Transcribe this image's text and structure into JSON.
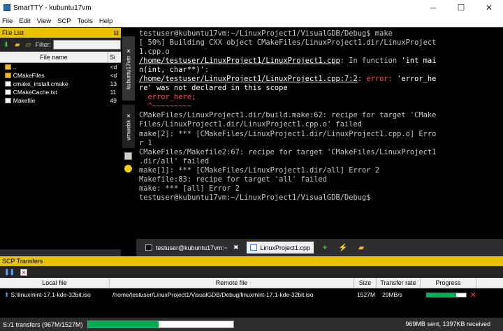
{
  "window": {
    "title": "SmarTTY - kubuntu17vm",
    "minimize": "─",
    "maximize": "☐",
    "close": "✕"
  },
  "menu": [
    "File",
    "Edit",
    "View",
    "SCP",
    "Tools",
    "Help"
  ],
  "file_list": {
    "title": "File List",
    "pin": "⊟",
    "filter_label": "Filter:",
    "filter_value": "",
    "columns": {
      "name": "File name",
      "size": "Si"
    },
    "rows": [
      {
        "name": "..",
        "size": "<d",
        "type": "folder"
      },
      {
        "name": "CMakeFiles",
        "size": "<d",
        "type": "folder"
      },
      {
        "name": "cmake_install.cmake",
        "size": "13",
        "type": "file"
      },
      {
        "name": "CMakeCache.txt",
        "size": "11",
        "type": "file"
      },
      {
        "name": "Makefile",
        "size": "49",
        "type": "file"
      }
    ]
  },
  "vertical_tabs": [
    {
      "label": "kubuntu17vm",
      "close": "✕"
    },
    {
      "label": "vmwebk",
      "close": "✕"
    }
  ],
  "terminal": {
    "lines": [
      [
        {
          "t": "testuser@kubuntu17vm:~/LinuxProject1/VisualGDB/Debug$ make",
          "c": ""
        }
      ],
      [
        {
          "t": "[ 50%] Building CXX object CMakeFiles/LinuxProject1.dir/LinuxProject",
          "c": ""
        }
      ],
      [
        {
          "t": "1.cpp.o",
          "c": ""
        }
      ],
      [
        {
          "t": "/home/testuser/LinuxProject1/LinuxProject1.cpp",
          "c": "u b"
        },
        {
          "t": ": In function ",
          "c": ""
        },
        {
          "t": "'int mai",
          "c": "b"
        }
      ],
      [
        {
          "t": "n(int, char**)'",
          "c": "b"
        },
        {
          "t": ":",
          "c": ""
        }
      ],
      [
        {
          "t": "/home/testuser/LinuxProject1/LinuxProject1.cpp:7:2",
          "c": "u b"
        },
        {
          "t": ": ",
          "c": ""
        },
        {
          "t": "error:",
          "c": "red"
        },
        {
          "t": " 'error_he",
          "c": "b"
        }
      ],
      [
        {
          "t": "re' was not declared in this scope",
          "c": "b"
        }
      ],
      [
        {
          "t": "  error_here;",
          "c": "red"
        }
      ],
      [
        {
          "t": "  ^~~~~~~~~~",
          "c": "red"
        }
      ],
      [
        {
          "t": "CMakeFiles/LinuxProject1.dir/build.make:62: recipe for target 'CMake",
          "c": ""
        }
      ],
      [
        {
          "t": "Files/LinuxProject1.dir/LinuxProject1.cpp.o' failed",
          "c": ""
        }
      ],
      [
        {
          "t": "make[2]: *** [CMakeFiles/LinuxProject1.dir/LinuxProject1.cpp.o] Erro",
          "c": ""
        }
      ],
      [
        {
          "t": "r 1",
          "c": ""
        }
      ],
      [
        {
          "t": "CMakeFiles/Makefile2:67: recipe for target 'CMakeFiles/LinuxProject1",
          "c": ""
        }
      ],
      [
        {
          "t": ".dir/all' failed",
          "c": ""
        }
      ],
      [
        {
          "t": "make[1]: *** [CMakeFiles/LinuxProject1.dir/all] Error 2",
          "c": ""
        }
      ],
      [
        {
          "t": "Makefile:83: recipe for target 'all' failed",
          "c": ""
        }
      ],
      [
        {
          "t": "make: *** [all] Error 2",
          "c": ""
        }
      ],
      [
        {
          "t": "testuser@kubuntu17vm:~/LinuxProject1/VisualGDB/Debug$",
          "c": ""
        }
      ]
    ]
  },
  "bottom_tabs": {
    "terminal_tab": "testuser@kubuntu17vm:~",
    "terminal_close": "✖",
    "file_tab": "LinuxProject1.cpp"
  },
  "scp": {
    "title": "SCP Transfers",
    "columns": [
      "Local file",
      "Remote file",
      "Size",
      "Transfer rate",
      "Progress"
    ],
    "rows": [
      {
        "local": "S:\\linuxmint-17.1-kde-32bit.iso",
        "remote": "/home/testuser/LinuxProject1/VisualGDB/Debug/linuxmint-17.1-kde-32bit.iso",
        "size": "1527M",
        "rate": "29MB/s",
        "progress": 0.75,
        "cancel": "✕"
      }
    ]
  },
  "status": {
    "summary": "S:/1 transfers (967M/1527M)",
    "progress": 0.49,
    "right": "969MB sent, 1397KB received"
  },
  "colors": {
    "panel_header": "#e6c200",
    "progress_fill": "#00b050",
    "error_red": "#ff4a4a",
    "terminal_bg": "#000000"
  }
}
